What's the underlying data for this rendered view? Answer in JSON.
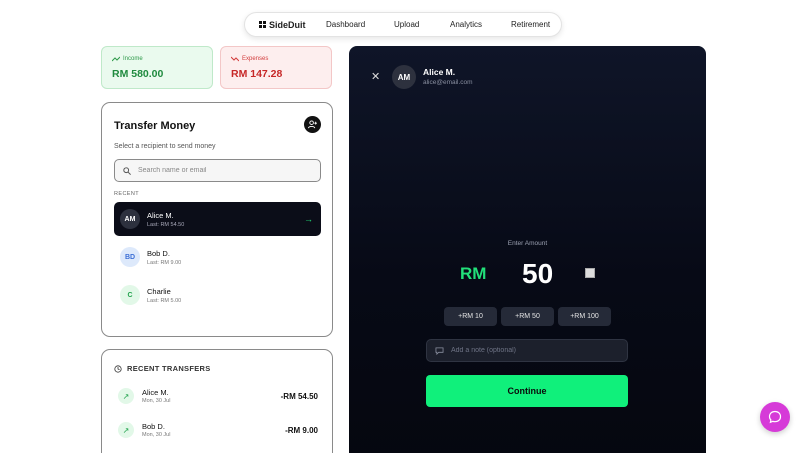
{
  "nav": {
    "brand": "SideDuit",
    "links": [
      "Dashboard",
      "Upload",
      "Analytics",
      "Retirement"
    ]
  },
  "stats": {
    "income": {
      "label": "Income",
      "value": "RM 580.00"
    },
    "expenses": {
      "label": "Expenses",
      "value": "RM 147.28"
    }
  },
  "transfer": {
    "title": "Transfer Money",
    "subtitle": "Select a recipient to send money",
    "search_placeholder": "Search name or email",
    "recent_label": "RECENT",
    "contacts": [
      {
        "initials": "AM",
        "name": "Alice M.",
        "last": "Last: RM 54.50"
      },
      {
        "initials": "BD",
        "name": "Bob D.",
        "last": "Last: RM 9.00"
      },
      {
        "initials": "C",
        "name": "Charlie",
        "last": "Last: RM 5.00"
      }
    ]
  },
  "recent_transfers": {
    "title": "RECENT TRANSFERS",
    "items": [
      {
        "name": "Alice M.",
        "date": "Mon, 30 Jul",
        "amount": "-RM 54.50"
      },
      {
        "name": "Bob D.",
        "date": "Mon, 30 Jul",
        "amount": "-RM 9.00"
      }
    ]
  },
  "panel": {
    "initials": "AM",
    "name": "Alice M.",
    "email": "alice@email.com",
    "enter_label": "Enter Amount",
    "currency": "RM",
    "amount": "50",
    "quick_amounts": [
      "+RM 10",
      "+RM 50",
      "+RM 100"
    ],
    "note_placeholder": "Add a note (optional)",
    "continue_label": "Continue"
  },
  "colors": {
    "accent_green": "#10f07b",
    "expense_red": "#c62828",
    "chat_button": "#d63ad8",
    "panel_bg": "#070a16"
  }
}
